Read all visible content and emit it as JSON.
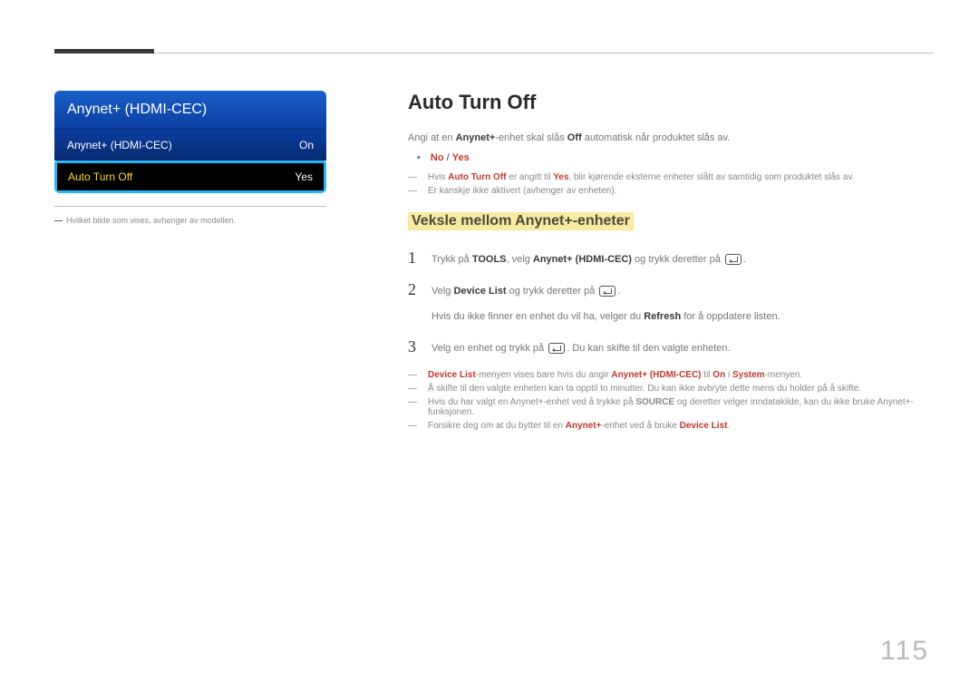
{
  "menu": {
    "title": "Anynet+ (HDMI-CEC)",
    "rows": [
      {
        "label": "Anynet+ (HDMI-CEC)",
        "value": "On"
      },
      {
        "label": "Auto Turn Off",
        "value": "Yes"
      }
    ]
  },
  "caption": {
    "prefix": "―",
    "text": "Hvilket bilde som vises, avhenger av modellen."
  },
  "heading": "Auto Turn Off",
  "intro": {
    "pre": "Angi at en ",
    "anynet": "Anynet+",
    "mid": "-enhet skal slås ",
    "off": "Off",
    "post": " automatisk når produktet slås av."
  },
  "option": {
    "no": "No",
    "sep": " / ",
    "yes": "Yes"
  },
  "note1": {
    "pre": "Hvis ",
    "ato": "Auto Turn Off",
    "mid": " er angitt til ",
    "yes": "Yes",
    "post": ", blir kjørende eksterne enheter slått av samtidig som produktet slås av."
  },
  "note2": "Er kanskje ikke aktivert (avhenger av enheten).",
  "subheading": "Veksle mellom Anynet+-enheter",
  "steps": {
    "s1": {
      "pre": "Trykk på ",
      "tools": "TOOLS",
      "mid": ", velg ",
      "anynet": "Anynet+ (HDMI-CEC)",
      "post": " og trykk deretter på "
    },
    "s2a": {
      "pre": "Velg ",
      "dl": "Device List",
      "post": " og trykk deretter på "
    },
    "s2b": {
      "pre": "Hvis du ikke finner en enhet du vil ha, velger du ",
      "refresh": "Refresh",
      "post": " for å oppdatere listen."
    },
    "s3": {
      "pre": "Velg en enhet og trykk på ",
      "post": ". Du kan skifte til den valgte enheten."
    }
  },
  "footnotes": {
    "f1": {
      "dl": "Device List",
      "mid": "-menyen vises bare hvis du angir ",
      "anynet": "Anynet+ (HDMI-CEC)",
      "to": " til ",
      "on": "On",
      "in": " i ",
      "system": "System",
      "post": "-menyen."
    },
    "f2": "Å skifte til den valgte enheten kan ta opptil to minutter. Du kan ikke avbryte dette mens du holder på å skifte.",
    "f3": {
      "pre": "Hvis du har valgt en Anynet+-enhet ved å trykke på ",
      "source": "SOURCE",
      "post": " og deretter velger inndatakilde, kan du ikke bruke Anynet+-funksjonen."
    },
    "f4": {
      "pre": "Forsikre deg om at du bytter til en ",
      "anynet": "Anynet+",
      "mid": "-enhet ved å bruke ",
      "dl": "Device List",
      "post": "."
    }
  },
  "page": "115"
}
